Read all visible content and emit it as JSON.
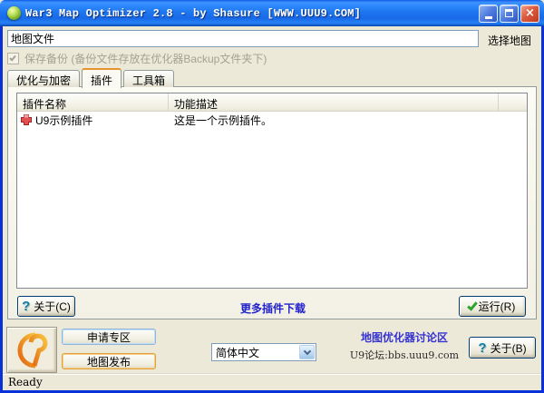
{
  "window": {
    "title": "War3 Map Optimizer 2.8 - by Shasure [WWW.UUU9.COM]"
  },
  "header": {
    "map_file_value": "地图文件",
    "select_map_label": "选择地图",
    "backup_label": "保存备份 (备份文件存放在优化器Backup文件夹下)"
  },
  "tabs": [
    {
      "label": "优化与加密",
      "selected": false
    },
    {
      "label": "插件",
      "selected": true
    },
    {
      "label": "工具箱",
      "selected": false
    }
  ],
  "plugin_list": {
    "columns": [
      "插件名称",
      "功能描述"
    ],
    "rows": [
      {
        "icon": "red-plus-plugin-icon",
        "name": "U9示例插件",
        "description": "这是一个示例插件。"
      }
    ]
  },
  "plugin_footer": {
    "about_label": "关于(C)",
    "more_link": "更多插件下载",
    "run_label": "运行(R)"
  },
  "bottom": {
    "apply_button": "申请专区",
    "publish_button": "地图发布",
    "language_value": "简体中文",
    "forum_title": "地图优化器讨论区",
    "forum_url": "U9论坛:bbs.uuu9.com",
    "about_label": "关于(B)"
  },
  "status": {
    "text": "Ready"
  },
  "colors": {
    "titlebar_blue": "#1C6FEB",
    "window_border": "#0831D9",
    "background": "#ECE9D8",
    "selected_tab_accent": "#E5932C",
    "link_blue": "#2222CC",
    "forum_link_blue": "#3533D1",
    "run_check_green": "#2FA32F",
    "close_button_red": "#DC5B3E",
    "plugin_icon_red": "#D03A3A"
  }
}
